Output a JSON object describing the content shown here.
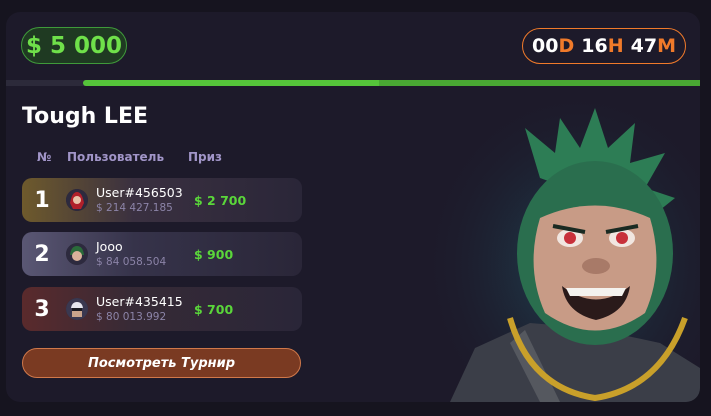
{
  "prize_pool": "$ 5 000",
  "timer": {
    "d_val": "00",
    "d_unit": "D",
    "h_val": "16",
    "h_unit": "H",
    "m_val": "47",
    "m_unit": "M"
  },
  "progress": {
    "fill_percent": 54
  },
  "tournament": {
    "name": "Tough LEE"
  },
  "table": {
    "headers": {
      "rank": "№",
      "user": "Пользователь",
      "prize": "Приз"
    },
    "rows": [
      {
        "rank": "1",
        "username": "User#456503",
        "value": "$ 214 427.185",
        "prize": "$ 2 700",
        "avatar_icon": "avatar-red-hair-icon"
      },
      {
        "rank": "2",
        "username": "Jooo",
        "value": "$ 84 058.504",
        "prize": "$ 900",
        "avatar_icon": "avatar-green-hair-icon"
      },
      {
        "rank": "3",
        "username": "User#435415",
        "value": "$ 80 013.992",
        "prize": "$ 700",
        "avatar_icon": "avatar-glasses-icon"
      }
    ]
  },
  "button": {
    "label": "Посмотреть Турнир"
  },
  "colors": {
    "accent_green": "#5ad63a",
    "accent_orange": "#f07a2a",
    "rank1": "#6e5a2c",
    "rank2": "#4a4762",
    "rank3": "#4b2a2d"
  }
}
